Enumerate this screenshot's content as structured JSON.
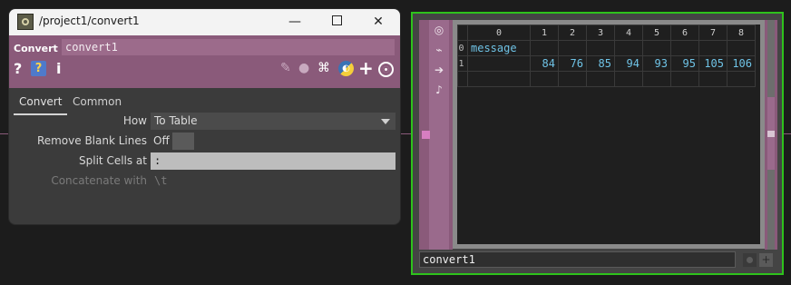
{
  "window": {
    "title": "/project1/convert1",
    "min_glyph": "—",
    "close_glyph": "✕"
  },
  "operator": {
    "type_label": "Convert",
    "name": "convert1",
    "help_glyph": "?",
    "info_glyph": "i",
    "color": "#8a5a7a"
  },
  "tabs": [
    "Convert",
    "Common"
  ],
  "params": {
    "how": {
      "label": "How",
      "value": "To Table"
    },
    "remove_blank_lines": {
      "label": "Remove Blank Lines",
      "value": "Off"
    },
    "split_cells_at": {
      "label": "Split Cells at",
      "value": ":"
    },
    "concatenate_with": {
      "label": "Concatenate with",
      "value": "\\t"
    }
  },
  "node": {
    "name": "convert1",
    "selected_color": "#2ec21c",
    "table": {
      "columns": [
        "0",
        "1",
        "2",
        "3",
        "4",
        "5",
        "6",
        "7",
        "8"
      ],
      "rows": [
        {
          "index": "0",
          "cells": [
            "message",
            "",
            "",
            "",
            "",
            "",
            "",
            "",
            ""
          ]
        },
        {
          "index": "1",
          "cells": [
            "",
            "84",
            "76",
            "85",
            "94",
            "93",
            "95",
            "105",
            "106"
          ]
        }
      ]
    }
  }
}
